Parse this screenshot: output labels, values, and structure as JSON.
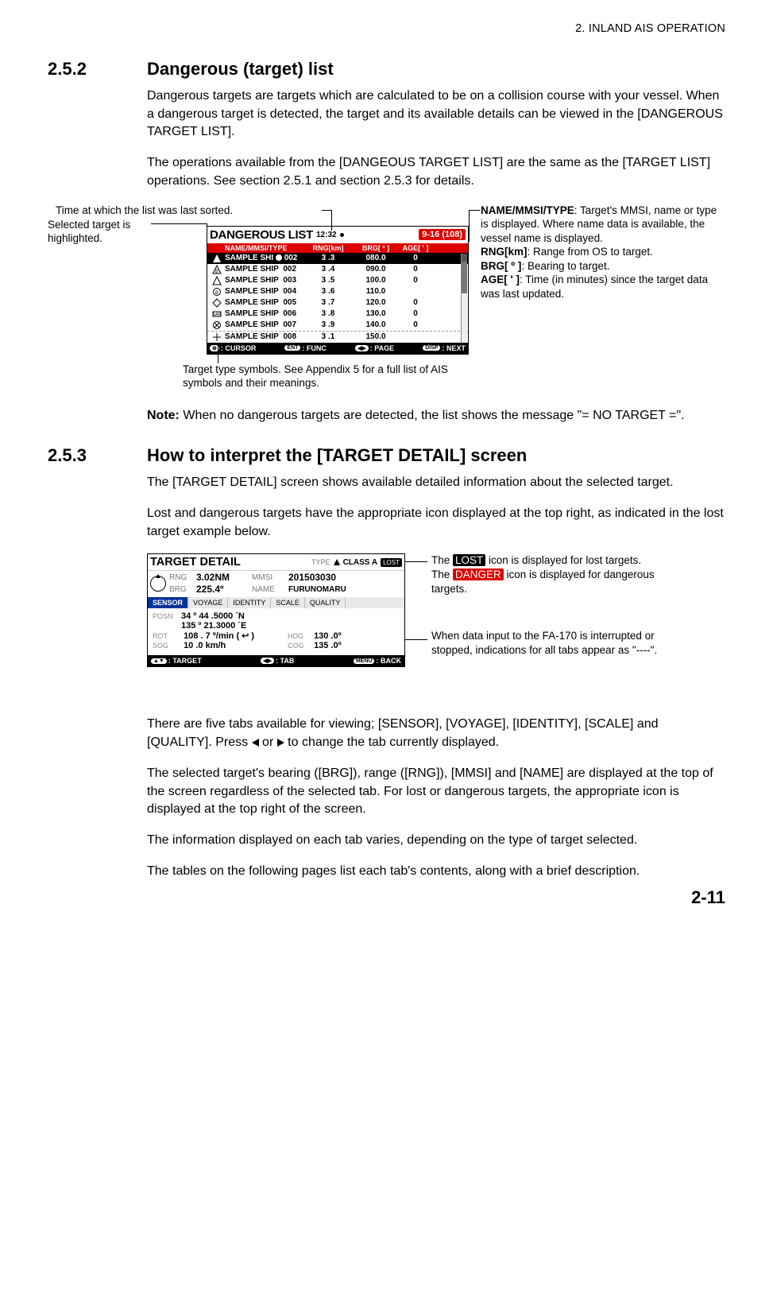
{
  "header": "2.  INLAND AIS OPERATION",
  "page_number": "2-11",
  "sec1": {
    "num": "2.5.2",
    "title": "Dangerous (target) list",
    "para1": "Dangerous targets are targets which are calculated to be on a collision course with your vessel. When a dangerous target is detected, the target and its available details can be viewed in the [DANGEROUS TARGET LIST].",
    "para2": "The operations available from the [DANGEOUS TARGET LIST] are the same as the [TARGET LIST] operations. See section 2.5.1 and section 2.5.3 for details.",
    "note_label": "Note:",
    "note_text": " When no dangerous targets are detected, the list shows the message \"= NO TARGET =\"."
  },
  "sec2": {
    "num": "2.5.3",
    "title": "How to interpret the [TARGET DETAIL] screen",
    "para1": "The [TARGET DETAIL] screen shows available detailed information about the selected target.",
    "para2": "Lost and dangerous targets have the appropriate icon displayed at the top right, as indicated in the lost target example below.",
    "para3a": "There are five tabs available for viewing; [SENSOR], [VOYAGE], [IDENTITY], [SCALE] and [QUALITY]. Press ",
    "para3b": " or ",
    "para3c": " to change the tab currently displayed.",
    "para4": "The selected target's bearing ([BRG]), range ([RNG]), [MMSI] and [NAME] are displayed at the top of the screen regardless of the selected tab. For lost or dangerous targets, the appropriate icon is displayed at the top right of the screen.",
    "para5": "The information displayed on each tab varies, depending on the type of target selected.",
    "para6": "The tables on the following pages list each tab's contents, along with a brief description."
  },
  "fig1": {
    "callout_time": "Time at which the list was last sorted.",
    "callout_selected": "Selected target is highlighted.",
    "callout_symbols": "Target type symbols. See Appendix 5 for a full list of AIS symbols and their meanings.",
    "callout_headers_name": "NAME/MMSI/TYPE",
    "callout_headers_name_txt": ": Target's MMSI, name or type is displayed. Where name data is available, the vessel name is displayed.",
    "callout_headers_rng": "RNG[km]",
    "callout_headers_rng_txt": ": Range from OS to target.",
    "callout_headers_brg": "BRG[ º ]",
    "callout_headers_brg_txt": ": Bearing to target.",
    "callout_headers_age": "AGE[ ' ]",
    "callout_headers_age_txt": ": Time (in minutes) since the target data was last updated.",
    "panel": {
      "title": "DANGEROUS LIST",
      "time": "12:32",
      "count_chip": "9-16 (108)",
      "cols": {
        "name": "NAME/MMSI/TYPE",
        "rng": "RNG[km]",
        "brg": "BRG[ º ]",
        "age": "AGE[ ' ]"
      },
      "rows": [
        {
          "name_a": "SAMPLE SHI",
          "name_b": "002",
          "rng": "3 .3",
          "brg": "080.0",
          "age": "0"
        },
        {
          "name_a": "SAMPLE SHIP",
          "name_b": "002",
          "rng": "3 .4",
          "brg": "090.0",
          "age": "0"
        },
        {
          "name_a": "SAMPLE SHIP",
          "name_b": "003",
          "rng": "3 .5",
          "brg": "100.0",
          "age": "0"
        },
        {
          "name_a": "SAMPLE SHIP",
          "name_b": "004",
          "rng": "3 .6",
          "brg": "110.0",
          "age": ""
        },
        {
          "name_a": "SAMPLE SHIP",
          "name_b": "005",
          "rng": "3 .7",
          "brg": "120.0",
          "age": "0"
        },
        {
          "name_a": "SAMPLE SHIP",
          "name_b": "006",
          "rng": "3 .8",
          "brg": "130.0",
          "age": "0"
        },
        {
          "name_a": "SAMPLE SHIP",
          "name_b": "007",
          "rng": "3 .9",
          "brg": "140.0",
          "age": "0"
        },
        {
          "name_a": "SAMPLE SHIP",
          "name_b": "008",
          "rng": "3 .1",
          "brg": "150.0",
          "age": ""
        }
      ],
      "ftr": {
        "cursor": ": CURSOR",
        "func": ": FUNC",
        "page": ": PAGE",
        "next": ": NEXT"
      }
    }
  },
  "fig2": {
    "callout_lost_a": "The ",
    "callout_lost_b": "LOST",
    "callout_lost_c": " icon is displayed for lost targets.",
    "callout_danger_a": "The ",
    "callout_danger_b": "DANGER",
    "callout_danger_c": " icon is displayed for dangerous targets.",
    "callout_interrupt": "When data input to the FA-170 is interrupted or stopped, indications for all tabs appear as \"----\".",
    "panel": {
      "title": "TARGET DETAIL",
      "type_lbl": "TYPE",
      "type_val": "CLASS A",
      "lost_chip": "LOST",
      "rng_lbl": "RNG",
      "rng_val": "3.02NM",
      "brg_lbl": "BRG",
      "brg_val": "225.4º",
      "mmsi_lbl": "MMSI",
      "mmsi_val": "201503030",
      "name_lbl": "NAME",
      "name_val": "FURUNOMARU",
      "tabs": [
        "SENSOR",
        "VOYAGE",
        "IDENTITY",
        "SCALE",
        "QUALITY"
      ],
      "posn_lbl": "POSN",
      "posn_lat": "34 º 44 .5000 ´N",
      "posn_lon": "135 º 21.3000 ´E",
      "rot_lbl": "ROT",
      "rot_val": "108 . 7 º/min ( ↩ )",
      "sog_lbl": "SOG",
      "sog_val": "10 .0 km/h",
      "hdg_lbl": "HDG",
      "hdg_val": "130 .0º",
      "cog_lbl": "COG",
      "cog_val": "135 .0º",
      "ftr": {
        "target": ": TARGET",
        "tab": ": TAB",
        "back": ": BACK"
      }
    }
  }
}
